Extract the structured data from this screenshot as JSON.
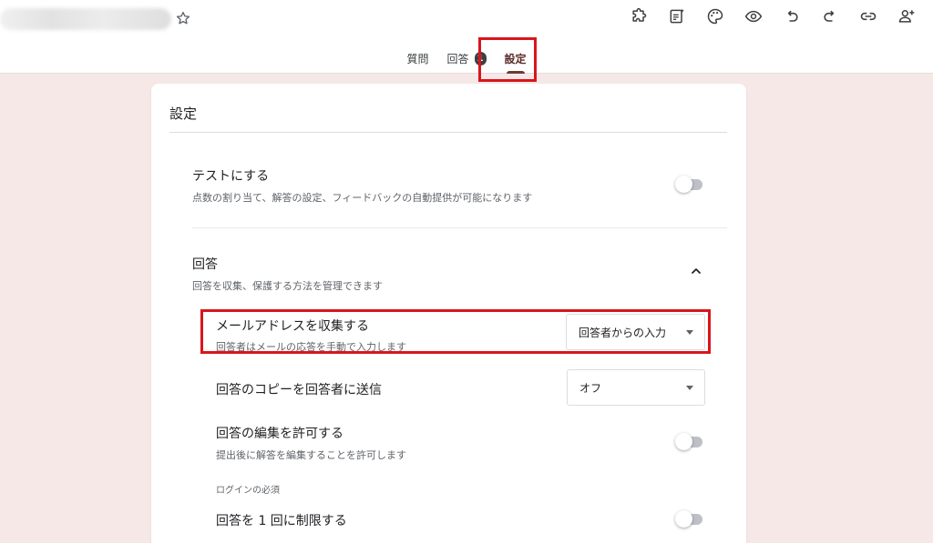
{
  "tabs": {
    "questions": "質問",
    "responses": "回答",
    "responses_count": "1",
    "settings": "設定"
  },
  "card": {
    "title": "設定"
  },
  "quiz": {
    "title": "テストにする",
    "description": "点数の割り当て、解答の設定、フィードバックの自動提供が可能になります"
  },
  "responses_section": {
    "title": "回答",
    "description": "回答を収集、保護する方法を管理できます"
  },
  "collect_email": {
    "title": "メールアドレスを収集する",
    "description": "回答者はメールの応答を手動で入力します",
    "selected": "回答者からの入力"
  },
  "send_copy": {
    "title": "回答のコピーを回答者に送信",
    "selected": "オフ"
  },
  "allow_edit": {
    "title": "回答の編集を許可する",
    "description": "提出後に解答を編集することを許可します"
  },
  "login_required": {
    "label": "ログインの必須"
  },
  "limit_one": {
    "title": "回答を 1 回に制限する"
  },
  "colors": {
    "accent": "#6b3b36",
    "background": "#f6e8e7",
    "highlight": "#d9151d"
  }
}
